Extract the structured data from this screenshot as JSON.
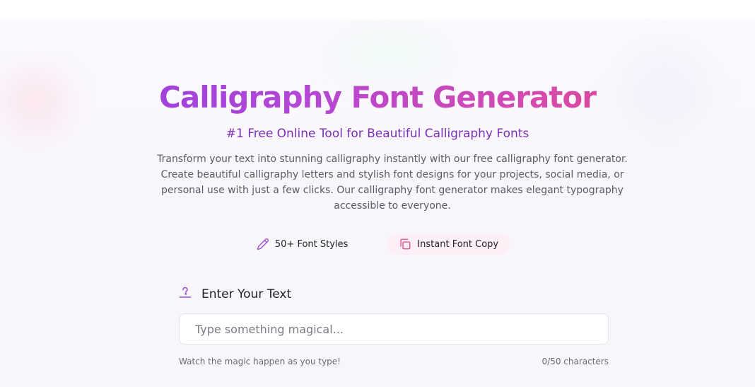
{
  "hero": {
    "title": "Calligraphy Font Generator",
    "subtitle": "#1 Free Online Tool for Beautiful Calligraphy Fonts",
    "description": "Transform your text into stunning calligraphy instantly with our free calligraphy font generator. Create beautiful calligraphy letters and stylish font designs for your projects, social media, or personal use with just a few clicks. Our calligraphy font generator makes elegant typography accessible to everyone."
  },
  "features": [
    {
      "label": "50+ Font Styles",
      "icon": "pen-icon"
    },
    {
      "label": "Instant Font Copy",
      "icon": "copy-icon"
    }
  ],
  "input": {
    "label": "Enter Your Text",
    "label_icon": "text-cursor-icon",
    "value": "",
    "placeholder": "Type something magical...",
    "hint": "Watch the magic happen as you type!",
    "counter": "0/50 characters"
  },
  "colors": {
    "title_gradient_start": "#8a3ce0",
    "title_gradient_end": "#d62e74",
    "subtitle": "#7a2fb4",
    "icon_purple": "#9b4fd0",
    "icon_pink": "#e04a8a"
  }
}
